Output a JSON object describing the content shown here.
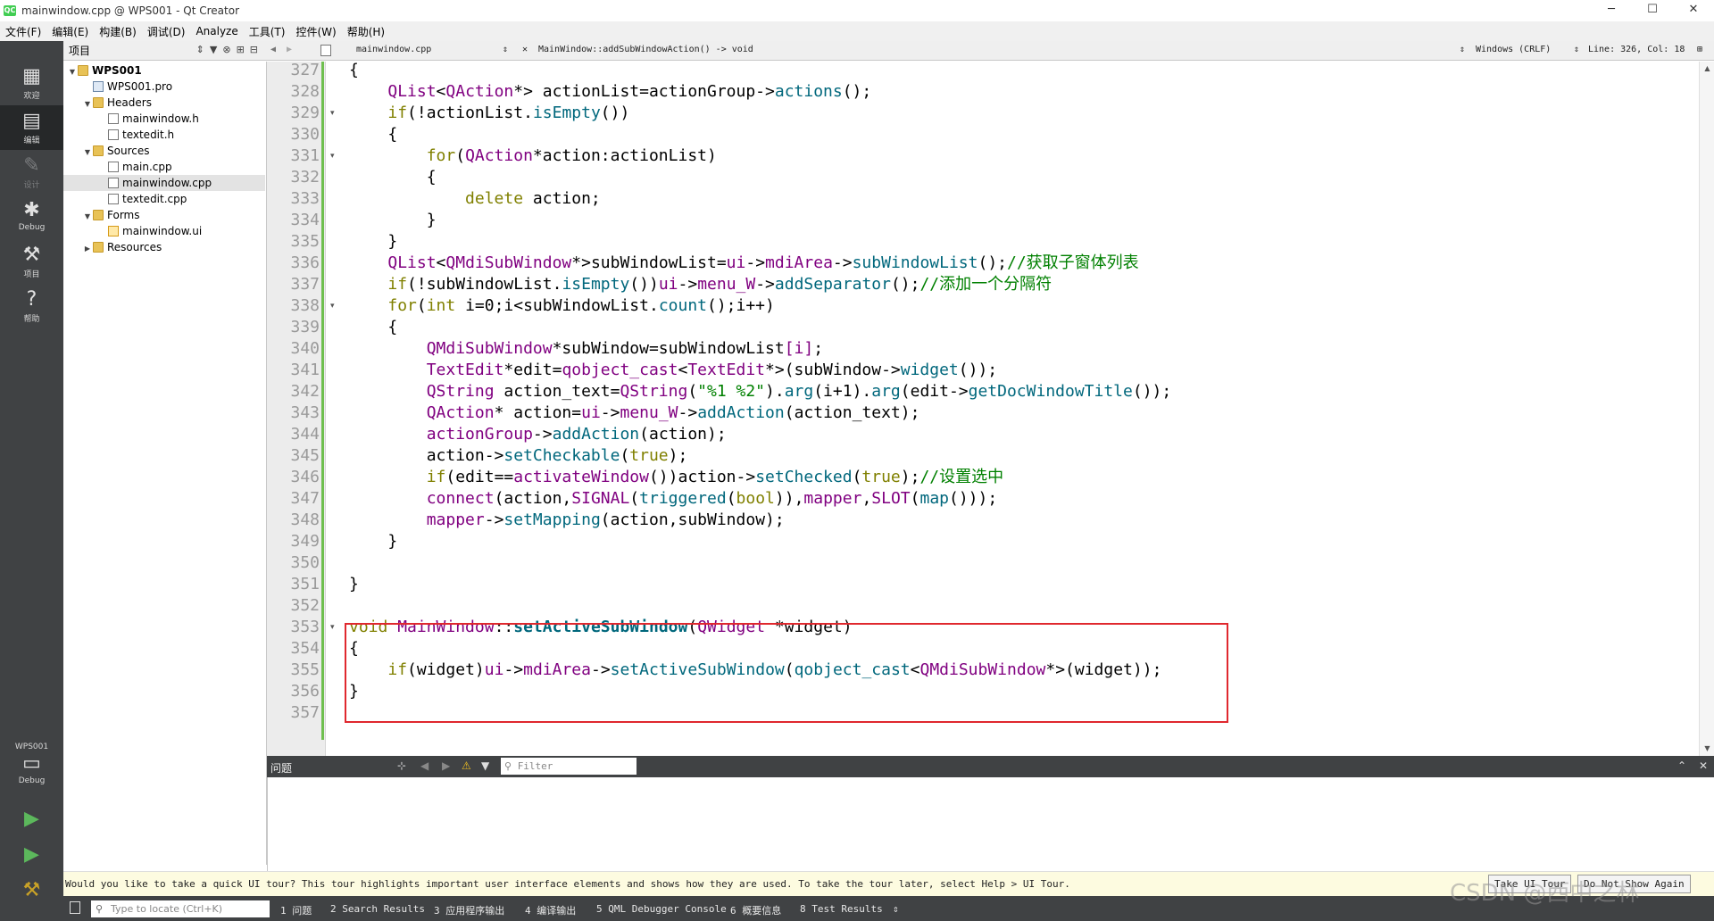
{
  "window": {
    "title": "mainwindow.cpp @ WPS001 - Qt Creator",
    "app_icon_text": "QC",
    "controls": {
      "minimize": "─",
      "maximize": "☐",
      "close": "✕"
    }
  },
  "menubar": {
    "items": [
      "文件(F)",
      "编辑(E)",
      "构建(B)",
      "调试(D)",
      "Analyze",
      "工具(T)",
      "控件(W)",
      "帮助(H)"
    ]
  },
  "modebar": {
    "modes": [
      {
        "label": "欢迎",
        "icon": "grid-icon",
        "glyph": "▦"
      },
      {
        "label": "编辑",
        "icon": "edit-document-icon",
        "glyph": "▤"
      },
      {
        "label": "设计",
        "icon": "pencil-icon",
        "glyph": "✎"
      },
      {
        "label": "Debug",
        "icon": "bug-icon",
        "glyph": "✱"
      },
      {
        "label": "项目",
        "icon": "wrench-icon",
        "glyph": "⚒"
      },
      {
        "label": "帮助",
        "icon": "help-icon",
        "glyph": "?"
      }
    ],
    "kit": {
      "project": "WPS001",
      "mode": "Debug",
      "glyph": "▭"
    },
    "run_glyph": "▶",
    "debug_run_glyph": "▶",
    "build_glyph": "⚒"
  },
  "project_panel": {
    "title": "项目",
    "tree": [
      {
        "name": "WPS001",
        "type": "project",
        "depth": 0,
        "expanded": true
      },
      {
        "name": "WPS001.pro",
        "type": "pro",
        "depth": 1
      },
      {
        "name": "Headers",
        "type": "folder",
        "depth": 1,
        "expanded": true
      },
      {
        "name": "mainwindow.h",
        "type": "file",
        "depth": 2
      },
      {
        "name": "textedit.h",
        "type": "file",
        "depth": 2
      },
      {
        "name": "Sources",
        "type": "folder",
        "depth": 1,
        "expanded": true
      },
      {
        "name": "main.cpp",
        "type": "file",
        "depth": 2
      },
      {
        "name": "mainwindow.cpp",
        "type": "file",
        "depth": 2,
        "selected": true
      },
      {
        "name": "textedit.cpp",
        "type": "file",
        "depth": 2
      },
      {
        "name": "Forms",
        "type": "folder",
        "depth": 1,
        "expanded": true
      },
      {
        "name": "mainwindow.ui",
        "type": "ui",
        "depth": 2
      },
      {
        "name": "Resources",
        "type": "folder",
        "depth": 1,
        "expanded": false
      }
    ]
  },
  "editor_toolbar": {
    "file": "mainwindow.cpp",
    "function": "MainWindow::addSubWindowAction() -> void",
    "line_ending": "Windows (CRLF)",
    "position": "Line: 326, Col: 18"
  },
  "editor": {
    "lines": [
      {
        "n": "327",
        "fold": false,
        "seg": [
          [
            "{",
            ""
          ]
        ]
      },
      {
        "n": "328",
        "fold": false,
        "seg": [
          [
            "    ",
            ""
          ],
          [
            "QList",
            "ty"
          ],
          [
            "<",
            ""
          ],
          [
            "QAction",
            "ty"
          ],
          [
            "*> actionList=actionGroup->",
            ""
          ],
          [
            "actions",
            "fn"
          ],
          [
            "();",
            ""
          ]
        ]
      },
      {
        "n": "329",
        "fold": true,
        "seg": [
          [
            "    ",
            ""
          ],
          [
            "if",
            "kw"
          ],
          [
            "(!actionList.",
            ""
          ],
          [
            "isEmpty",
            "fn"
          ],
          [
            "())",
            ""
          ]
        ]
      },
      {
        "n": "330",
        "fold": false,
        "seg": [
          [
            "    {",
            ""
          ]
        ]
      },
      {
        "n": "331",
        "fold": true,
        "seg": [
          [
            "        ",
            ""
          ],
          [
            "for",
            "kw"
          ],
          [
            "(",
            ""
          ],
          [
            "QAction",
            "ty"
          ],
          [
            "*action:actionList)",
            ""
          ]
        ]
      },
      {
        "n": "332",
        "fold": false,
        "seg": [
          [
            "        {",
            ""
          ]
        ]
      },
      {
        "n": "333",
        "fold": false,
        "seg": [
          [
            "            ",
            ""
          ],
          [
            "delete",
            "kw"
          ],
          [
            " action;",
            ""
          ]
        ]
      },
      {
        "n": "334",
        "fold": false,
        "seg": [
          [
            "        }",
            ""
          ]
        ]
      },
      {
        "n": "335",
        "fold": false,
        "seg": [
          [
            "    }",
            ""
          ]
        ]
      },
      {
        "n": "336",
        "fold": false,
        "seg": [
          [
            "    ",
            ""
          ],
          [
            "QList",
            "ty"
          ],
          [
            "<",
            ""
          ],
          [
            "QMdiSubWindow",
            "ty"
          ],
          [
            "*>subWindowList=",
            ""
          ],
          [
            "ui",
            "ty"
          ],
          [
            "->",
            ""
          ],
          [
            "mdiArea",
            "ty"
          ],
          [
            "->",
            ""
          ],
          [
            "subWindowList",
            "fn"
          ],
          [
            "();",
            ""
          ],
          [
            "//获取子窗体列表",
            "cm"
          ]
        ]
      },
      {
        "n": "337",
        "fold": false,
        "seg": [
          [
            "    ",
            ""
          ],
          [
            "if",
            "kw"
          ],
          [
            "(!subWindowList.",
            ""
          ],
          [
            "isEmpty",
            "fn"
          ],
          [
            "())",
            ""
          ],
          [
            "ui",
            "ty"
          ],
          [
            "->",
            ""
          ],
          [
            "menu_W",
            "ty"
          ],
          [
            "->",
            ""
          ],
          [
            "addSeparator",
            "fn"
          ],
          [
            "();",
            ""
          ],
          [
            "//添加一个分隔符",
            "cm"
          ]
        ]
      },
      {
        "n": "338",
        "fold": true,
        "seg": [
          [
            "    ",
            ""
          ],
          [
            "for",
            "kw"
          ],
          [
            "(",
            ""
          ],
          [
            "int",
            "kw"
          ],
          [
            " i=0;i<subWindowList.",
            ""
          ],
          [
            "count",
            "fn"
          ],
          [
            "();i++)",
            ""
          ]
        ]
      },
      {
        "n": "339",
        "fold": false,
        "seg": [
          [
            "    {",
            ""
          ]
        ]
      },
      {
        "n": "340",
        "fold": false,
        "seg": [
          [
            "        ",
            ""
          ],
          [
            "QMdiSubWindow",
            "ty"
          ],
          [
            "*subWindow=subWindowList",
            ""
          ],
          [
            "[i]",
            "ty"
          ],
          [
            ";",
            ""
          ]
        ]
      },
      {
        "n": "341",
        "fold": false,
        "seg": [
          [
            "        ",
            ""
          ],
          [
            "TextEdit",
            "ty"
          ],
          [
            "*edit=",
            ""
          ],
          [
            "qobject_cast",
            "ty"
          ],
          [
            "<",
            ""
          ],
          [
            "TextEdit",
            "ty"
          ],
          [
            "*>(subWindow->",
            ""
          ],
          [
            "widget",
            "fn"
          ],
          [
            "());",
            ""
          ]
        ]
      },
      {
        "n": "342",
        "fold": false,
        "seg": [
          [
            "        ",
            ""
          ],
          [
            "QString",
            "ty"
          ],
          [
            " action_text=",
            ""
          ],
          [
            "QString",
            "ty"
          ],
          [
            "(",
            ""
          ],
          [
            "\"%1 %2\"",
            "st"
          ],
          [
            ").",
            ""
          ],
          [
            "arg",
            "fn"
          ],
          [
            "(i+1).",
            ""
          ],
          [
            "arg",
            "fn"
          ],
          [
            "(edit->",
            ""
          ],
          [
            "getDocWindowTitle",
            "fn"
          ],
          [
            "());",
            ""
          ]
        ]
      },
      {
        "n": "343",
        "fold": false,
        "seg": [
          [
            "        ",
            ""
          ],
          [
            "QAction",
            "ty"
          ],
          [
            "* action=",
            ""
          ],
          [
            "ui",
            "ty"
          ],
          [
            "->",
            ""
          ],
          [
            "menu_W",
            "ty"
          ],
          [
            "->",
            ""
          ],
          [
            "addAction",
            "fn"
          ],
          [
            "(action_text);",
            ""
          ]
        ]
      },
      {
        "n": "344",
        "fold": false,
        "seg": [
          [
            "        ",
            ""
          ],
          [
            "actionGroup",
            "ty"
          ],
          [
            "->",
            ""
          ],
          [
            "addAction",
            "fn"
          ],
          [
            "(action);",
            ""
          ]
        ]
      },
      {
        "n": "345",
        "fold": false,
        "seg": [
          [
            "        action->",
            ""
          ],
          [
            "setCheckable",
            "fn"
          ],
          [
            "(",
            ""
          ],
          [
            "true",
            "kw"
          ],
          [
            ");",
            ""
          ]
        ]
      },
      {
        "n": "346",
        "fold": false,
        "seg": [
          [
            "        ",
            ""
          ],
          [
            "if",
            "kw"
          ],
          [
            "(edit==",
            ""
          ],
          [
            "activateWindow",
            "ty"
          ],
          [
            "())action->",
            ""
          ],
          [
            "setChecked",
            "fn"
          ],
          [
            "(",
            ""
          ],
          [
            "true",
            "kw"
          ],
          [
            ");",
            ""
          ],
          [
            "//设置选中",
            "cm"
          ]
        ]
      },
      {
        "n": "347",
        "fold": false,
        "seg": [
          [
            "        ",
            ""
          ],
          [
            "connect",
            "ty"
          ],
          [
            "(action,",
            ""
          ],
          [
            "SIGNAL",
            "ty"
          ],
          [
            "(",
            ""
          ],
          [
            "triggered",
            "fn"
          ],
          [
            "(",
            ""
          ],
          [
            "bool",
            "kw"
          ],
          [
            ")),",
            ""
          ],
          [
            "mapper",
            "ty"
          ],
          [
            ",",
            ""
          ],
          [
            "SLOT",
            "ty"
          ],
          [
            "(",
            ""
          ],
          [
            "map",
            "fn"
          ],
          [
            "()));",
            ""
          ]
        ]
      },
      {
        "n": "348",
        "fold": false,
        "seg": [
          [
            "        ",
            ""
          ],
          [
            "mapper",
            "ty"
          ],
          [
            "->",
            ""
          ],
          [
            "setMapping",
            "fn"
          ],
          [
            "(action,subWindow);",
            ""
          ]
        ]
      },
      {
        "n": "349",
        "fold": false,
        "seg": [
          [
            "    }",
            ""
          ]
        ]
      },
      {
        "n": "350",
        "fold": false,
        "seg": [
          [
            "",
            ""
          ]
        ]
      },
      {
        "n": "351",
        "fold": false,
        "seg": [
          [
            "}",
            ""
          ]
        ]
      },
      {
        "n": "352",
        "fold": false,
        "seg": [
          [
            "",
            ""
          ]
        ]
      },
      {
        "n": "353",
        "fold": true,
        "seg": [
          [
            "void",
            "kw"
          ],
          [
            " ",
            ""
          ],
          [
            "MainWindow",
            "ty"
          ],
          [
            "::",
            ""
          ],
          [
            "setActiveSubWindow",
            "bf"
          ],
          [
            "(",
            ""
          ],
          [
            "QWidget",
            "ty"
          ],
          [
            " *widget)",
            ""
          ]
        ]
      },
      {
        "n": "354",
        "fold": false,
        "seg": [
          [
            "{",
            ""
          ]
        ]
      },
      {
        "n": "355",
        "fold": false,
        "seg": [
          [
            "    ",
            ""
          ],
          [
            "if",
            "kw"
          ],
          [
            "(widget)",
            ""
          ],
          [
            "ui",
            "ty"
          ],
          [
            "->",
            ""
          ],
          [
            "mdiArea",
            "ty"
          ],
          [
            "->",
            ""
          ],
          [
            "setActiveSubWindow",
            "fn"
          ],
          [
            "(",
            ""
          ],
          [
            "qobject_cast",
            "fn"
          ],
          [
            "<",
            ""
          ],
          [
            "QMdiSubWindow",
            "ty"
          ],
          [
            "*>(widget));",
            ""
          ]
        ]
      },
      {
        "n": "356",
        "fold": false,
        "seg": [
          [
            "}",
            ""
          ]
        ]
      },
      {
        "n": "357",
        "fold": false,
        "seg": [
          [
            "",
            ""
          ]
        ]
      }
    ],
    "highlight_color": "#e0282e"
  },
  "issues_panel": {
    "title": "问题",
    "filter_placeholder": "Filter"
  },
  "notice": {
    "message": "Would you like to take a quick UI tour? This tour highlights important user interface elements and shows how they are used. To take the tour later, select Help > UI Tour.",
    "take_tour": "Take UI Tour",
    "dont_show": "Do Not Show Again"
  },
  "statusbar": {
    "locate_placeholder": "Type to locate (Ctrl+K)",
    "tabs": [
      "1 问题",
      "2 Search Results",
      "3 应用程序输出",
      "4 编译输出",
      "5 QML Debugger Console",
      "6 概要信息",
      "8 Test Results"
    ]
  },
  "watermark": "CSDN @西中之林",
  "colors": {
    "accent_green": "#6fbf4f",
    "mode_bar": "#404244",
    "highlight_box": "#e0282e"
  }
}
